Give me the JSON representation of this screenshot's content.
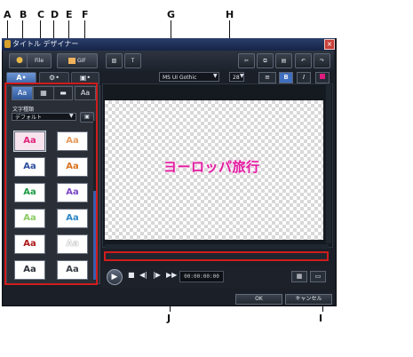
{
  "callouts": {
    "A": "A",
    "B": "B",
    "C": "C",
    "D": "D",
    "E": "E",
    "F": "F",
    "G": "G",
    "H": "H",
    "I": "I",
    "J": "J"
  },
  "window": {
    "title": "タイトル デザイナー",
    "close_glyph": "×"
  },
  "toolbar": {
    "btn1_label": "File",
    "btn2_label": "GIF",
    "icon_undo": "undo-icon",
    "icon_redo": "redo-icon"
  },
  "tabs": [
    {
      "label": "A•"
    },
    {
      "label": "⚙•"
    },
    {
      "label": "▣•"
    }
  ],
  "subtabs": [
    "Aa",
    "▦",
    "▬",
    "Aa"
  ],
  "panel": {
    "category_label": "文字種類",
    "category_value": "デフォルト"
  },
  "presets": [
    {
      "text": "Aa",
      "color": "#e0257c",
      "bg": "#f8e4ee"
    },
    {
      "text": "Aa",
      "color": "#e79a5c",
      "bg": "#ffffff"
    },
    {
      "text": "Aa",
      "color": "#2e4f9e",
      "bg": "#ffffff"
    },
    {
      "text": "Aa",
      "color": "#d8731f",
      "bg": "#ffffff"
    },
    {
      "text": "Aa",
      "color": "#1d9b44",
      "bg": "#ffffff"
    },
    {
      "text": "Aa",
      "color": "#7a47c7",
      "bg": "#ffffff"
    },
    {
      "text": "Aa",
      "color": "#8acb66",
      "bg": "#ffffff"
    },
    {
      "text": "Aa",
      "color": "#2d86c7",
      "bg": "#ffffff"
    },
    {
      "text": "Aa",
      "color": "#b01818",
      "bg": "#ffffff"
    },
    {
      "text": "Aa",
      "color": "#f4f4f4",
      "bg": "#ffffff"
    },
    {
      "text": "Aa",
      "color": "#2c3038",
      "bg": "#ffffff"
    },
    {
      "text": "Aa",
      "color": "#3a3e46",
      "bg": "#ffffff"
    }
  ],
  "fontbar": {
    "font_name": "MS UI Gothic",
    "font_size": "28",
    "align_glyph": "≡",
    "bold": "B",
    "italic": "I"
  },
  "stage": {
    "text": "ヨーロッパ旅行"
  },
  "transport": {
    "play": "▶",
    "stop": "■",
    "prev": "◀|",
    "next": "|▶",
    "fast": "▶▶",
    "timecode": "00:00:00:00"
  },
  "buttons": {
    "ok": "OK",
    "cancel": "キャンセル"
  },
  "colors": {
    "accent": "#3e68ab",
    "highlight": "#d11c1c",
    "title_text": "#e21ba0"
  }
}
